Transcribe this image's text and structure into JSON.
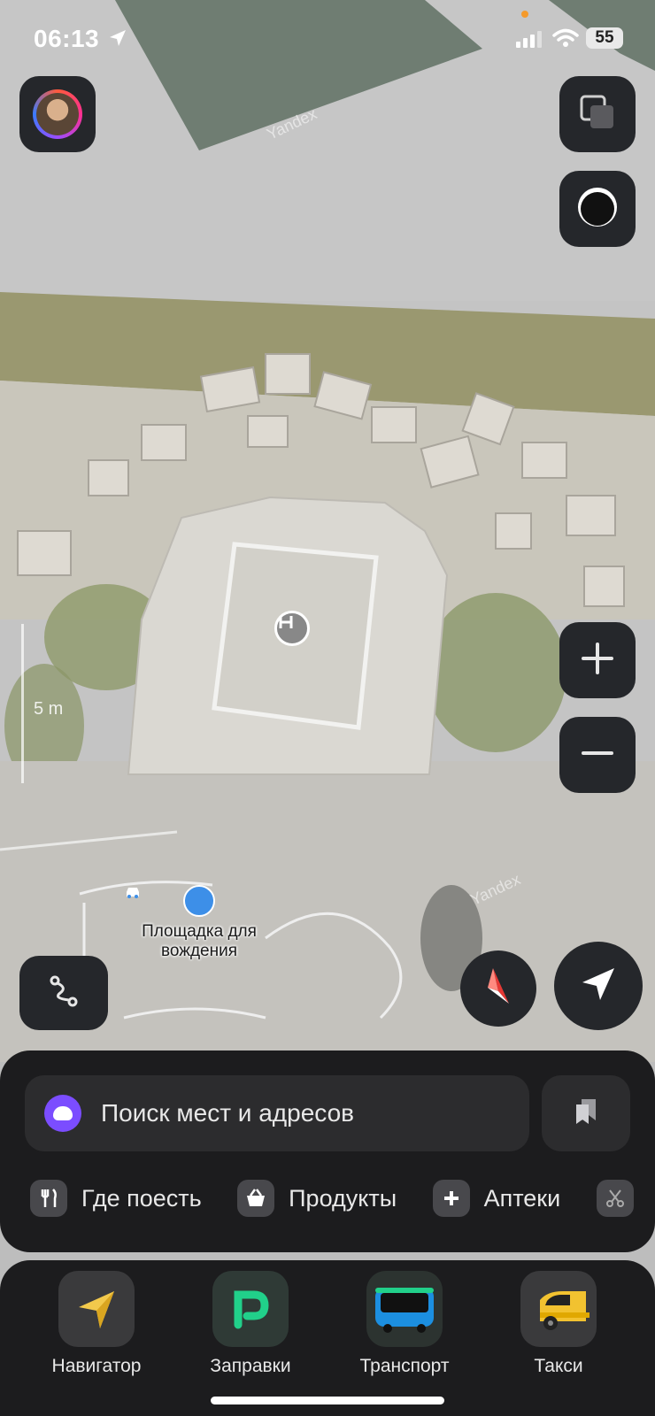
{
  "status_bar": {
    "time": "06:13",
    "battery": "55"
  },
  "map": {
    "poi": {
      "name": "Площадка для вождения",
      "icon": "car-icon",
      "color": "#3d8fe8"
    },
    "scale": "5 m",
    "watermark": "Yandex",
    "helipad_icon": "helipad-icon"
  },
  "search": {
    "placeholder": "Поиск мест и адресов"
  },
  "categories": [
    {
      "label": "Где поесть",
      "icon": "fork-knife-icon"
    },
    {
      "label": "Продукты",
      "icon": "basket-icon"
    },
    {
      "label": "Аптеки",
      "icon": "plus-icon"
    }
  ],
  "dock": [
    {
      "label": "Навигатор",
      "icon": "navigator-arrow-icon"
    },
    {
      "label": "Заправки",
      "icon": "fuel-p-icon"
    },
    {
      "label": "Транспорт",
      "icon": "bus-icon"
    },
    {
      "label": "Такси",
      "icon": "taxi-car-icon"
    }
  ],
  "colors": {
    "panel": "#1c1c1e",
    "button": "#25272b",
    "accent_alice": "#7b4dff",
    "fuel_green": "#21d08a"
  }
}
